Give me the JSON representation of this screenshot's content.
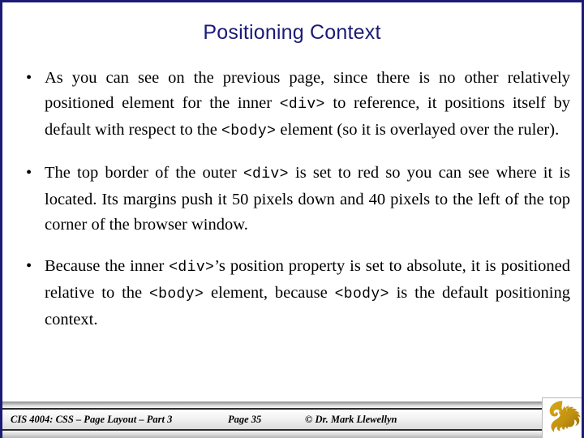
{
  "slide": {
    "title": "Positioning Context",
    "title_color": "#1b1b76",
    "border_color": "#1b1b76",
    "background": "#ffffff"
  },
  "bullets": [
    {
      "marker": "•",
      "segments": [
        {
          "type": "text",
          "value": "As you can see on the previous page, since there is no other relatively positioned element for the inner "
        },
        {
          "type": "code",
          "value": "<div>"
        },
        {
          "type": "text",
          "value": " to reference, it positions itself by default with respect to the "
        },
        {
          "type": "code",
          "value": "<body>"
        },
        {
          "type": "text",
          "value": " element (so it is overlayed over the ruler)."
        }
      ],
      "plain": "As you can see on the previous page, since there is no other relatively positioned element for the inner <div> to reference, it positions itself by default with respect to the <body> element (so it is overlayed over the ruler)."
    },
    {
      "marker": "•",
      "segments": [
        {
          "type": "text",
          "value": "The top border of the outer "
        },
        {
          "type": "code",
          "value": "<div>"
        },
        {
          "type": "text",
          "value": " is set to red so you can see where it is located.  Its margins push it 50 pixels down and 40 pixels to the left of the top corner of the browser window."
        }
      ],
      "plain": "The top border of the outer <div> is set to red so you can see where it is located. Its margins push it 50 pixels down and 40 pixels to the left of the top corner of the browser window."
    },
    {
      "marker": "•",
      "segments": [
        {
          "type": "text",
          "value": "Because the inner "
        },
        {
          "type": "code",
          "value": "<div>"
        },
        {
          "type": "text",
          "value": "’s position property is set to absolute, it is positioned relative to the "
        },
        {
          "type": "code",
          "value": "<body>"
        },
        {
          "type": "text",
          "value": " element, because "
        },
        {
          "type": "code",
          "value": "<body>"
        },
        {
          "type": "text",
          "value": " is the default positioning context."
        }
      ],
      "plain": "Because the inner <div>’s position property is set to absolute, it is positioned relative to the <body> element, because <body> is the default positioning context."
    }
  ],
  "footer": {
    "course": "CIS 4004: CSS – Page Layout – Part 3",
    "page": "Page 35",
    "copyright": "© Dr. Mark Llewellyn",
    "logo_name": "ucf-pegasus-logo",
    "logo_color": "#C59512",
    "logo_color_dark": "#9d760b"
  }
}
